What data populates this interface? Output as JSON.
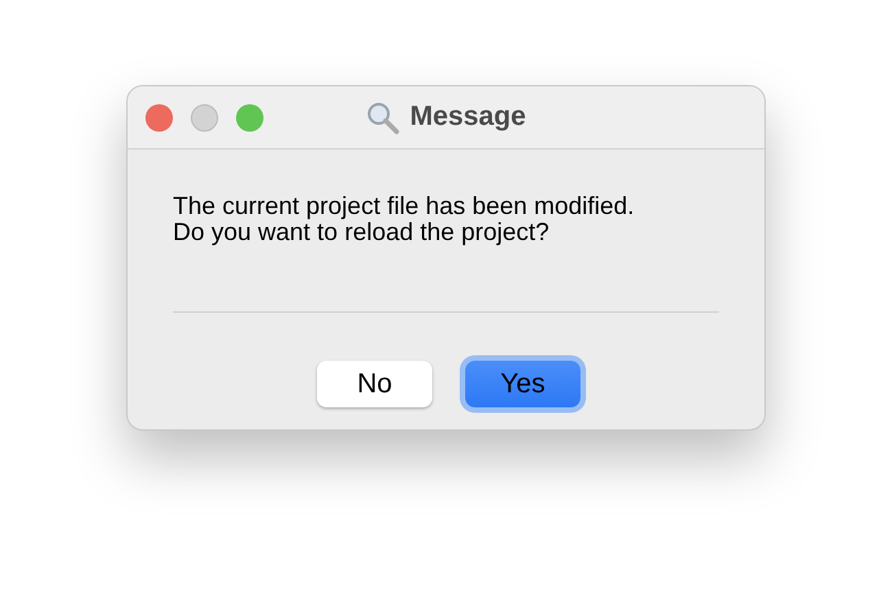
{
  "window": {
    "title": "Message",
    "controls": [
      {
        "kind": "close",
        "disabled": false
      },
      {
        "kind": "minimize",
        "disabled": true
      },
      {
        "kind": "zoom",
        "disabled": false
      }
    ]
  },
  "message": {
    "lines": [
      "The current project file has been modified.",
      "Do you want to reload the project?"
    ]
  },
  "buttons": [
    {
      "label": "No",
      "default": false
    },
    {
      "label": "Yes",
      "default": true
    }
  ]
}
